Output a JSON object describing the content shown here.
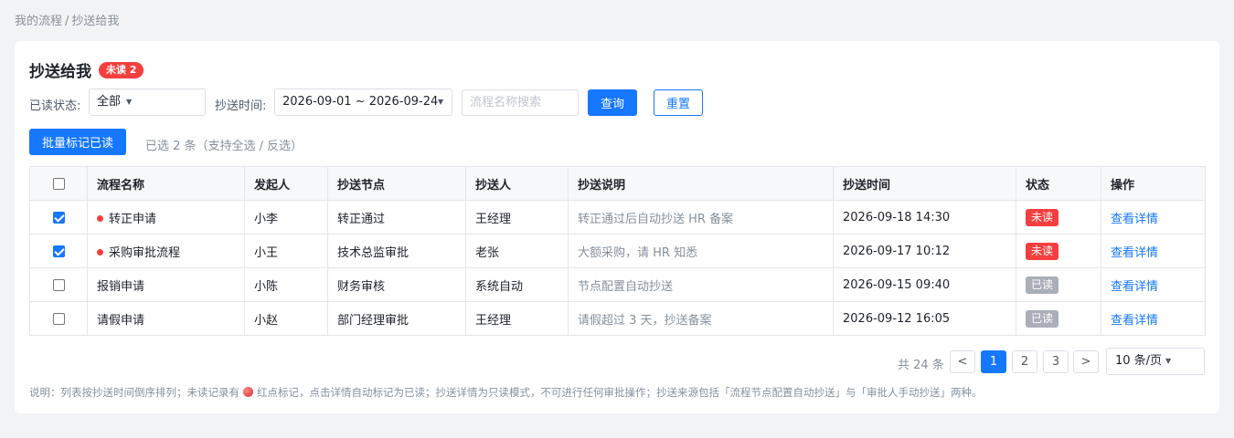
{
  "breadcrumb": {
    "parent": "我的流程",
    "separator": "/",
    "current": "抄送给我"
  },
  "header": {
    "title": "抄送给我",
    "badge": "未读 2"
  },
  "filters": {
    "read_status_label": "已读状态:",
    "read_status_value": "全部",
    "time_label": "抄送时间:",
    "time_value": "2026-09-01 ~ 2026-09-24",
    "search_placeholder": "流程名称搜索",
    "query_label": "查询",
    "reset_label": "重置"
  },
  "batch": {
    "button_label": "批量标记已读",
    "hint": "已选 2 条（支持全选 / 反选）"
  },
  "table": {
    "columns": [
      "流程名称",
      "发起人",
      "抄送节点",
      "抄送人",
      "抄送说明",
      "抄送时间",
      "状态",
      "操作"
    ],
    "rows": [
      {
        "checked": true,
        "unread": true,
        "name": "转正申请",
        "initiator": "小李",
        "node": "转正通过",
        "cc_by": "王经理",
        "desc": "转正通过后自动抄送 HR 备案",
        "time": "2026-09-18 14:30",
        "status": "未读",
        "action": "查看详情"
      },
      {
        "checked": true,
        "unread": true,
        "name": "采购审批流程",
        "initiator": "小王",
        "node": "技术总监审批",
        "cc_by": "老张",
        "desc": "大额采购，请 HR 知悉",
        "time": "2026-09-17 10:12",
        "status": "未读",
        "action": "查看详情"
      },
      {
        "checked": false,
        "unread": false,
        "name": "报销申请",
        "initiator": "小陈",
        "node": "财务审核",
        "cc_by": "系统自动",
        "desc": "节点配置自动抄送",
        "time": "2026-09-15 09:40",
        "status": "已读",
        "action": "查看详情"
      },
      {
        "checked": false,
        "unread": false,
        "name": "请假申请",
        "initiator": "小赵",
        "node": "部门经理审批",
        "cc_by": "王经理",
        "desc": "请假超过 3 天，抄送备案",
        "time": "2026-09-12 16:05",
        "status": "已读",
        "action": "查看详情"
      }
    ]
  },
  "pagination": {
    "total": "共 24 条",
    "prev": "<",
    "pages": [
      "1",
      "2",
      "3"
    ],
    "current_page": "1",
    "next": ">",
    "page_size": "10 条/页"
  },
  "note": {
    "before_dot": "说明：列表按抄送时间倒序排列；未读记录有",
    "after_dot": "红点标记，点击详情自动标记为已读；抄送详情为只读模式，不可进行任何审批操作；抄送来源包括「流程节点配置自动抄送」与「审批人手动抄送」两种。"
  },
  "colors": {
    "primary": "#1677ff",
    "danger": "#f53f3f",
    "read_tag": "#a9aeb8"
  }
}
